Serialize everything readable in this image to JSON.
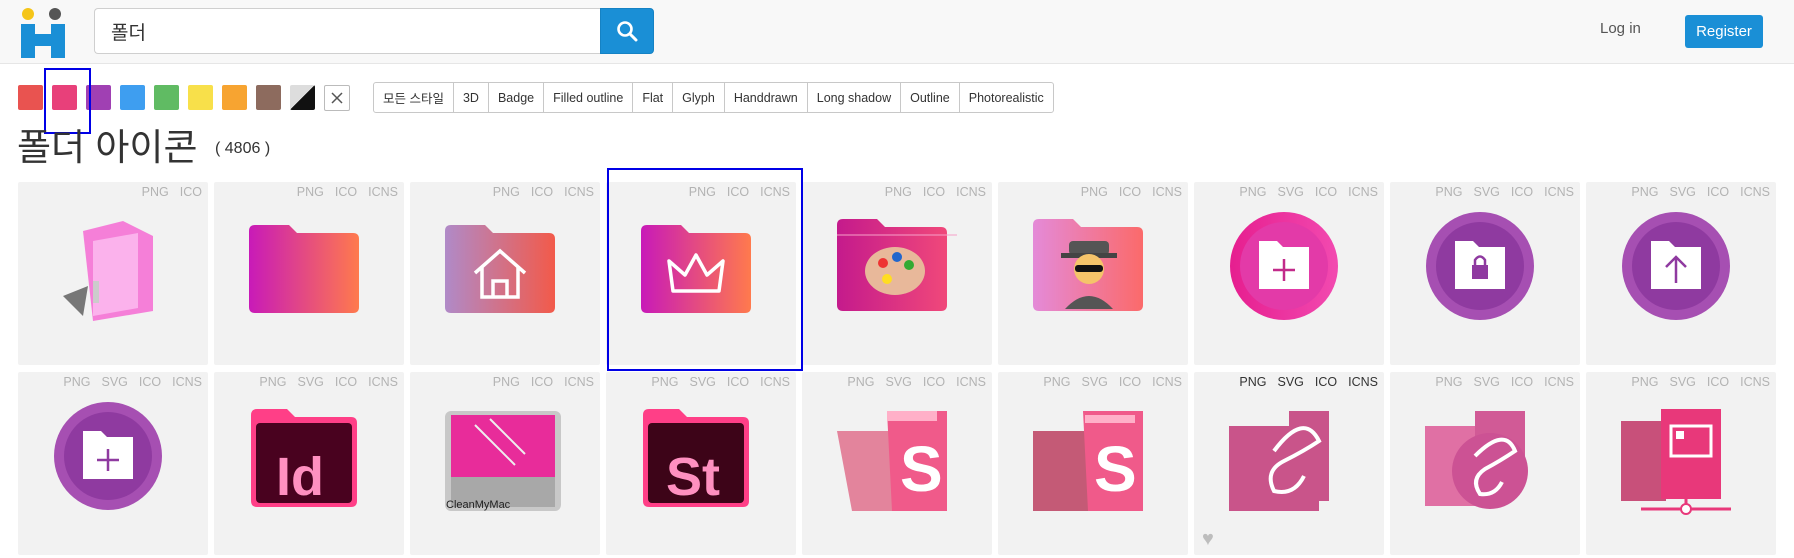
{
  "search": {
    "value": "폴더"
  },
  "header": {
    "login_label": "Log in",
    "register_label": "Register"
  },
  "colors": [
    "#e95350",
    "#e8407a",
    "#a040b3",
    "#3e9ef0",
    "#60bb63",
    "#f8e04a",
    "#f7a431",
    "#8d6b5e"
  ],
  "styles": [
    "모든 스타일",
    "3D",
    "Badge",
    "Filled outline",
    "Flat",
    "Glyph",
    "Handdrawn",
    "Long shadow",
    "Outline",
    "Photorealistic"
  ],
  "page": {
    "title": "폴더 아이콘",
    "count": "( 4806 )"
  },
  "icons": [
    {
      "name": "folder-3d-icon",
      "formats": [
        "PNG",
        "ICO"
      ]
    },
    {
      "name": "folder-gradient-icon",
      "formats": [
        "PNG",
        "ICO",
        "ICNS"
      ]
    },
    {
      "name": "home-folder-icon",
      "formats": [
        "PNG",
        "ICO",
        "ICNS"
      ]
    },
    {
      "name": "crown-folder-icon",
      "formats": [
        "PNG",
        "ICO",
        "ICNS"
      ]
    },
    {
      "name": "palette-folder-icon",
      "formats": [
        "PNG",
        "ICO",
        "ICNS"
      ]
    },
    {
      "name": "spy-folder-icon",
      "formats": [
        "PNG",
        "ICO",
        "ICNS"
      ]
    },
    {
      "name": "add-folder-circle-icon",
      "formats": [
        "PNG",
        "SVG",
        "ICO",
        "ICNS"
      ]
    },
    {
      "name": "lock-folder-circle-icon",
      "formats": [
        "PNG",
        "SVG",
        "ICO",
        "ICNS"
      ]
    },
    {
      "name": "upload-folder-circle-icon",
      "formats": [
        "PNG",
        "SVG",
        "ICO",
        "ICNS"
      ]
    },
    {
      "name": "add-folder-purple-circle-icon",
      "formats": [
        "PNG",
        "SVG",
        "ICO",
        "ICNS"
      ]
    },
    {
      "name": "indesign-folder-icon",
      "formats": [
        "PNG",
        "SVG",
        "ICO",
        "ICNS"
      ],
      "text": "Id"
    },
    {
      "name": "cleanmymac-icon",
      "formats": [
        "PNG",
        "ICO",
        "ICNS"
      ],
      "text": "CleanMyMac"
    },
    {
      "name": "stock-folder-icon",
      "formats": [
        "PNG",
        "SVG",
        "ICO",
        "ICNS"
      ],
      "text": "St"
    },
    {
      "name": "s-folder-icon",
      "formats": [
        "PNG",
        "SVG",
        "ICO",
        "ICNS"
      ],
      "text": "S"
    },
    {
      "name": "s-folder-dark-icon",
      "formats": [
        "PNG",
        "SVG",
        "ICO",
        "ICNS"
      ],
      "text": "S"
    },
    {
      "name": "sass-folder-icon",
      "formats": [
        "PNG",
        "SVG",
        "ICO",
        "ICNS"
      ],
      "dark": true
    },
    {
      "name": "sass-folder-circle-icon",
      "formats": [
        "PNG",
        "SVG",
        "ICO",
        "ICNS"
      ]
    },
    {
      "name": "network-folder-icon",
      "formats": [
        "PNG",
        "SVG",
        "ICO",
        "ICNS"
      ]
    }
  ]
}
